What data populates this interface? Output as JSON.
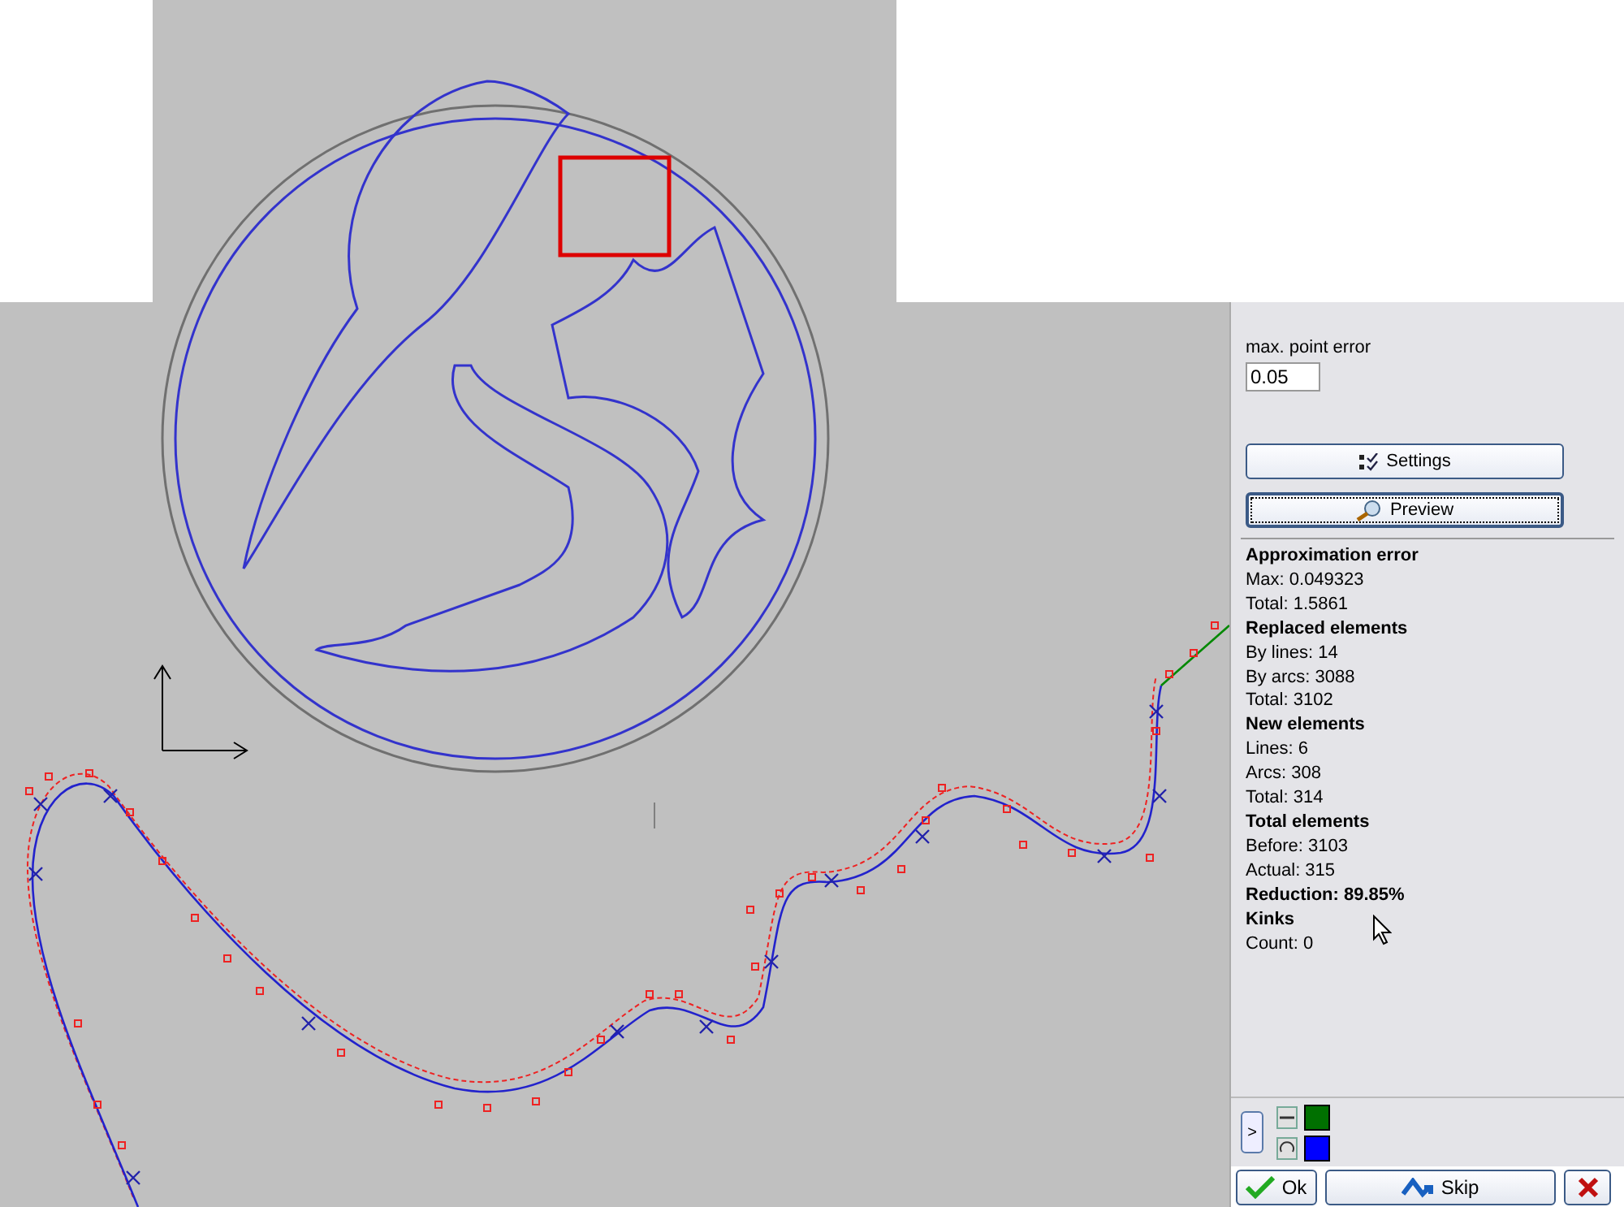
{
  "panel": {
    "field_label": "max. point error",
    "field_value": "0.05",
    "buttons": [
      {
        "label": "Settings",
        "kind": "settings",
        "focused": false
      },
      {
        "label": "Preview",
        "kind": "preview",
        "focused": true
      }
    ]
  },
  "stats": [
    {
      "kind": "heading",
      "text": "Approximation error"
    },
    {
      "kind": "line",
      "text": "Max: 0.049323"
    },
    {
      "kind": "line",
      "text": "Total: 1.5861"
    },
    {
      "kind": "heading",
      "text": "Replaced elements"
    },
    {
      "kind": "line",
      "text": "By lines: 14"
    },
    {
      "kind": "line",
      "text": "By arcs: 3088"
    },
    {
      "kind": "line",
      "text": "Total: 3102"
    },
    {
      "kind": "heading",
      "text": "New elements"
    },
    {
      "kind": "line",
      "text": "Lines: 6"
    },
    {
      "kind": "line",
      "text": "Arcs: 308"
    },
    {
      "kind": "line",
      "text": "Total: 314"
    },
    {
      "kind": "heading",
      "text": "Total elements"
    },
    {
      "kind": "line",
      "text": "Before: 3103"
    },
    {
      "kind": "line",
      "text": "Actual: 315"
    },
    {
      "kind": "heading",
      "text": "Reduction: 89.85%"
    },
    {
      "kind": "heading",
      "text": "Kinks"
    },
    {
      "kind": "line",
      "text": "Count: 0"
    }
  ],
  "expand_button": ">",
  "legend": [
    {
      "kind": "line",
      "color": "#007000"
    },
    {
      "kind": "arc",
      "color": "#0000ff"
    }
  ],
  "actions": [
    {
      "kind": "ok",
      "label": "Ok"
    },
    {
      "kind": "skip",
      "label": "Skip"
    },
    {
      "kind": "cancel"
    }
  ]
}
